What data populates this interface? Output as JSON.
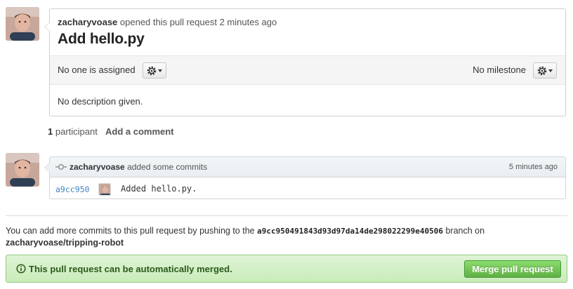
{
  "discussion": {
    "author": "zacharyvoase",
    "action": "opened this pull request",
    "time": "2 minutes ago",
    "title": "Add hello.py",
    "assignee_text": "No one is assigned",
    "milestone_text": "No milestone",
    "description": "No description given."
  },
  "participants": {
    "count": "1",
    "label": "participant",
    "add_comment": "Add a comment"
  },
  "commits": {
    "author": "zacharyvoase",
    "action": "added some commits",
    "time": "5 minutes ago",
    "items": [
      {
        "sha": "a9cc950",
        "message": "Added hello.py."
      }
    ]
  },
  "push_info": {
    "prefix": "You can add more commits to this pull request by pushing to the",
    "branch": "a9cc950491843d93d97da14de298022299e40506",
    "suffix": "branch on",
    "repo": "zacharyvoase/tripping-robot"
  },
  "merge": {
    "status": "This pull request can be automatically merged.",
    "button_label": "Merge pull request"
  },
  "colors": {
    "link": "#4183c4",
    "merge_bg": "#c9ecb9",
    "merge_button": "#60b044"
  },
  "icons": {
    "settings": "gear-icon",
    "commit": "commit-icon",
    "merge_status": "info-icon"
  }
}
